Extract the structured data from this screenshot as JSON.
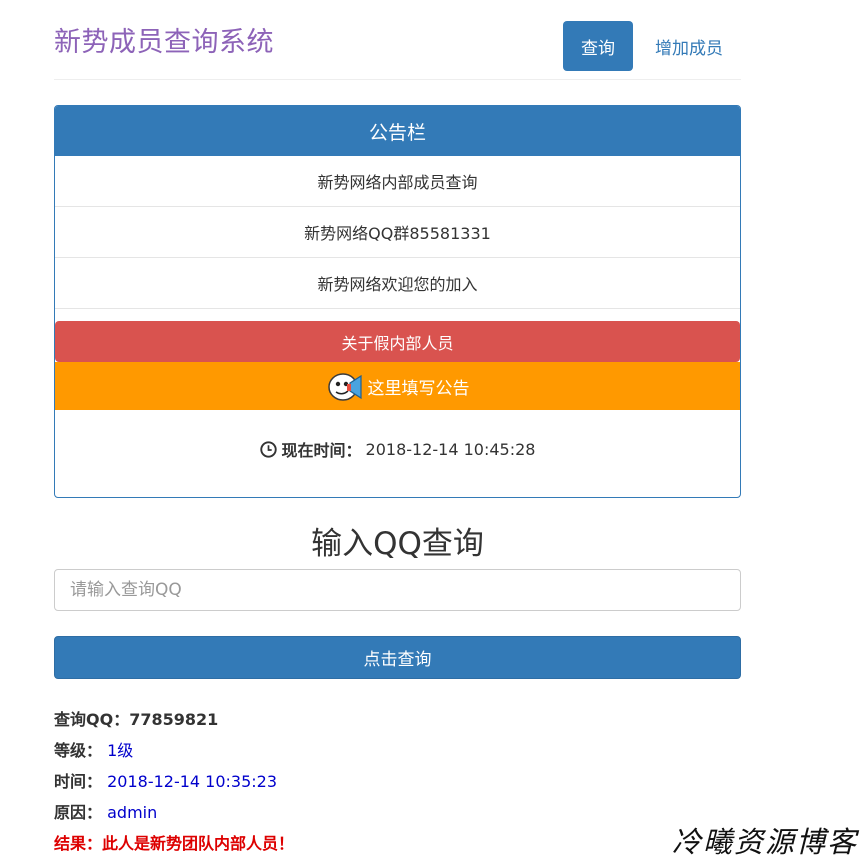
{
  "header": {
    "site_title": "新势成员查询系统",
    "nav": [
      {
        "label": "查询",
        "active": true
      },
      {
        "label": "增加成员",
        "active": false
      }
    ]
  },
  "notice_panel": {
    "heading": "公告栏",
    "items": [
      "新势网络内部成员查询",
      "新势网络QQ群85581331",
      "新势网络欢迎您的加入"
    ],
    "fake_member_button": "关于假内部人员",
    "announcement": "这里填写公告",
    "time_label": "现在时间：",
    "time_value": "2018-12-14 10:45:28"
  },
  "query": {
    "title": "输入QQ查询",
    "input_placeholder": "请输入查询QQ",
    "input_value": "",
    "submit_label": "点击查询"
  },
  "result": {
    "qq_label": "查询QQ：",
    "qq_value": "77859821",
    "level_label": "等级：",
    "level_value": "1级",
    "time_label": "时间：",
    "time_value": "2018-12-14 10:35:23",
    "reason_label": "原因：",
    "reason_value": "admin",
    "final": "结果：此人是新势团队内部人员！"
  },
  "watermark": "冷曦资源博客",
  "colors": {
    "primary": "#337ab7",
    "title_purple": "#8d63b8",
    "danger": "#d9534f",
    "announce_orange": "#ff9900",
    "result_blue": "#0000cc",
    "result_red": "#dd0000"
  },
  "icons": {
    "clock": "clock-icon",
    "announce": "megaphone-mascot-icon"
  }
}
